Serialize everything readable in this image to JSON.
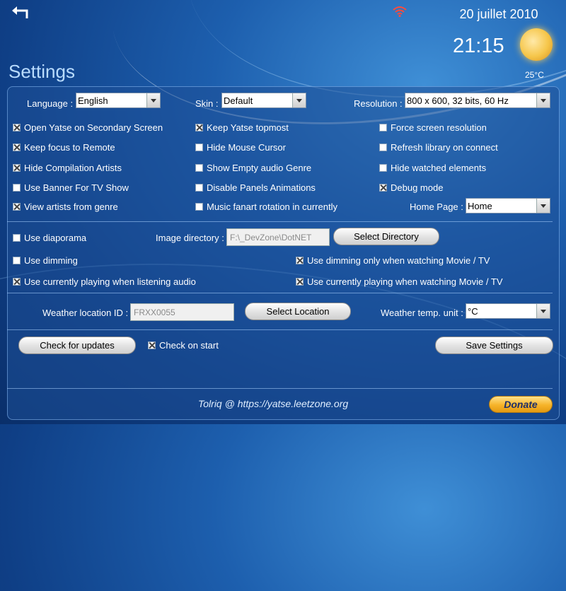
{
  "header": {
    "date": "20 juillet 2010",
    "time": "21:15",
    "temperature": "25°C",
    "title": "Settings"
  },
  "general": {
    "language_label": "Language :",
    "language_value": "English",
    "skin_label": "Skin :",
    "skin_value": "Default",
    "resolution_label": "Resolution :",
    "resolution_value": "800 x 600, 32 bits, 60 Hz"
  },
  "options": {
    "open_secondary": {
      "label": "Open Yatse on Secondary Screen",
      "checked": true
    },
    "keep_topmost": {
      "label": "Keep Yatse topmost",
      "checked": true
    },
    "force_resolution": {
      "label": "Force screen resolution",
      "checked": false
    },
    "keep_focus": {
      "label": "Keep focus to Remote",
      "checked": true
    },
    "hide_cursor": {
      "label": "Hide Mouse Cursor",
      "checked": false
    },
    "refresh_library": {
      "label": "Refresh library on connect",
      "checked": false
    },
    "hide_compilation": {
      "label": "Hide Compilation Artists",
      "checked": true
    },
    "show_empty_genre": {
      "label": "Show Empty audio Genre",
      "checked": false
    },
    "hide_watched": {
      "label": "Hide watched elements",
      "checked": false
    },
    "use_banner": {
      "label": "Use Banner For TV Show",
      "checked": false
    },
    "disable_animations": {
      "label": "Disable Panels Animations",
      "checked": false
    },
    "debug_mode": {
      "label": "Debug mode",
      "checked": true
    },
    "view_artists": {
      "label": "View artists from genre",
      "checked": true
    },
    "music_fanart": {
      "label": "Music fanart rotation in currently",
      "checked": false
    }
  },
  "home_page": {
    "label": "Home Page :",
    "value": "Home"
  },
  "diaporama": {
    "use_diaporama": {
      "label": "Use diaporama",
      "checked": false
    },
    "image_dir_label": "Image directory :",
    "image_dir_value": "F:\\_DevZone\\DotNET",
    "select_dir_button": "Select Directory"
  },
  "dimming": {
    "use_dimming": {
      "label": "Use dimming",
      "checked": false
    },
    "dimming_watching": {
      "label": "Use dimming only when watching Movie / TV",
      "checked": true
    },
    "playing_audio": {
      "label": "Use currently playing when listening audio",
      "checked": true
    },
    "playing_movie": {
      "label": "Use currently playing when watching Movie / TV",
      "checked": true
    }
  },
  "weather": {
    "location_label": "Weather location ID :",
    "location_value": "FRXX0055",
    "select_location_button": "Select Location",
    "unit_label": "Weather temp. unit :",
    "unit_value": "°C"
  },
  "updates": {
    "check_button": "Check for updates",
    "check_on_start": {
      "label": "Check on start",
      "checked": true
    },
    "save_button": "Save Settings"
  },
  "footer": {
    "credit": "Tolriq @ https://yatse.leetzone.org",
    "donate": "Donate"
  }
}
